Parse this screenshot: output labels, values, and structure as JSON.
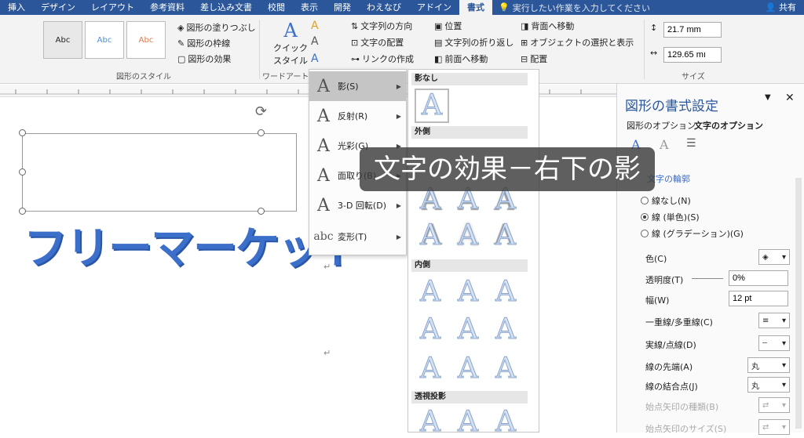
{
  "tabs": [
    "挿入",
    "デザイン",
    "レイアウト",
    "参考資料",
    "差し込み文書",
    "校閲",
    "表示",
    "開発",
    "わえなび",
    "アドイン",
    "書式"
  ],
  "active_tab": "書式",
  "tell_me": "実行したい作業を入力してください",
  "share": "共有",
  "ribbon": {
    "fill": "図形の塗りつぶし",
    "outline": "図形の枠線",
    "effect": "図形の効果",
    "shape_styles_group": "図形のスタイル",
    "quick_style_1": "クイック",
    "quick_style_2": "スタイル",
    "wordart_group": "ワードアートの",
    "text_direction": "文字列の方向",
    "align_text": "文字の配置",
    "create_link": "リンクの作成",
    "position": "位置",
    "wrap_text": "文字列の折り返し",
    "bring_forward": "前面へ移動",
    "send_backward": "背面へ移動",
    "selection_pane": "オブジェクトの選択と表示",
    "align": "配置",
    "height": "21.7 mm",
    "width": "129.65 mı",
    "size_group": "サイズ",
    "sample": "Abc"
  },
  "document": {
    "wordart_text": "フリーマーケット",
    "para_mark": "↵"
  },
  "text_effects_menu": [
    {
      "label": "影(S)",
      "glyph": "A"
    },
    {
      "label": "反射(R)",
      "glyph": "A"
    },
    {
      "label": "光彩(G)",
      "glyph": "A"
    },
    {
      "label": "面取り(B)",
      "glyph": "A"
    },
    {
      "label": "3-D 回転(D)",
      "glyph": "A"
    },
    {
      "label": "変形(T)",
      "glyph": "abc"
    }
  ],
  "shadow_gallery": {
    "no_shadow": "影なし",
    "outer": "外側",
    "inner": "内側",
    "perspective": "透視投影",
    "glyph": "A"
  },
  "pane": {
    "title": "図形の書式設定",
    "tab_shape": "図形のオプション",
    "tab_text": "文字のオプション",
    "section": "文字の輪郭",
    "no_line": "線なし(N)",
    "solid_line": "線 (単色)(S)",
    "gradient_line": "線 (グラデーション)(G)",
    "color": "色(C)",
    "transparency": "透明度(T)",
    "transparency_value": "0%",
    "width": "幅(W)",
    "width_value": "12 pt",
    "compound": "一重線/多重線(C)",
    "dash": "実線/点線(D)",
    "cap": "線の先端(A)",
    "cap_value": "丸",
    "join": "線の結合点(J)",
    "join_value": "丸",
    "begin_arrow_type": "始点矢印の種類(B)",
    "begin_arrow_size": "始点矢印のサイズ(S)"
  },
  "caption": "文字の効果－右下の影",
  "colors": {
    "tab_bar": "#2b579a",
    "wordart": "#3b6fc9"
  }
}
